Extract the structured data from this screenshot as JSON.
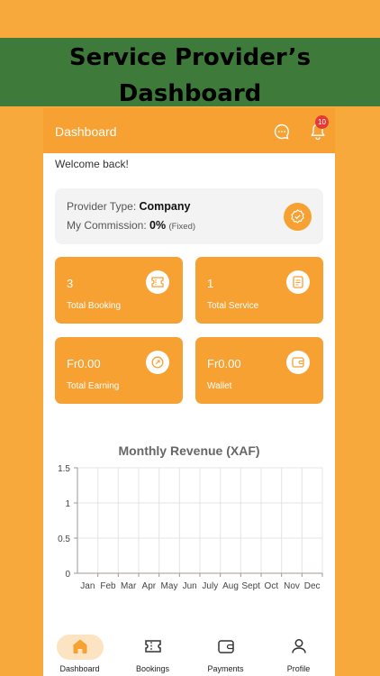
{
  "banner": {
    "title": "Service Provider’s Dashboard"
  },
  "header": {
    "title": "Dashboard",
    "notification_count": "10",
    "icons": [
      "chat-icon",
      "bell-icon"
    ]
  },
  "welcome": "Welcome back!",
  "provider": {
    "type_label": "Provider Type:",
    "type_value": "Company",
    "commission_label": "My Commission:",
    "commission_value": "0%",
    "commission_note": "(Fixed)",
    "icon": "verified-badge-icon"
  },
  "stats": [
    {
      "value": "3",
      "label": "Total Booking",
      "icon": "ticket-icon"
    },
    {
      "value": "1",
      "label": "Total Service",
      "icon": "document-icon"
    },
    {
      "value": "Fr0.00",
      "label": "Total Earning",
      "icon": "coin-icon"
    },
    {
      "value": "Fr0.00",
      "label": "Wallet",
      "icon": "wallet-icon"
    }
  ],
  "colors": {
    "accent": "#F6A132",
    "banner": "#3E7B3A",
    "background": "#F7A93C",
    "badge": "#E53935"
  },
  "chart_data": {
    "type": "line",
    "title": "Monthly Revenue (XAF)",
    "categories": [
      "Jan",
      "Feb",
      "Mar",
      "Apr",
      "May",
      "Jun",
      "July",
      "Aug",
      "Sept",
      "Oct",
      "Nov",
      "Dec"
    ],
    "series": [
      {
        "values": [
          0,
          0,
          0,
          0,
          0,
          0,
          0,
          0,
          0,
          0,
          0,
          0
        ]
      }
    ],
    "ylim": [
      0,
      1.5
    ],
    "yticks": [
      "0",
      "0.5",
      "1",
      "1.5"
    ],
    "grid": true
  },
  "nav": [
    {
      "label": "Dashboard",
      "icon": "home-icon",
      "active": true
    },
    {
      "label": "Bookings",
      "icon": "ticket-icon",
      "active": false
    },
    {
      "label": "Payments",
      "icon": "wallet-icon",
      "active": false
    },
    {
      "label": "Profile",
      "icon": "user-icon",
      "active": false
    }
  ]
}
